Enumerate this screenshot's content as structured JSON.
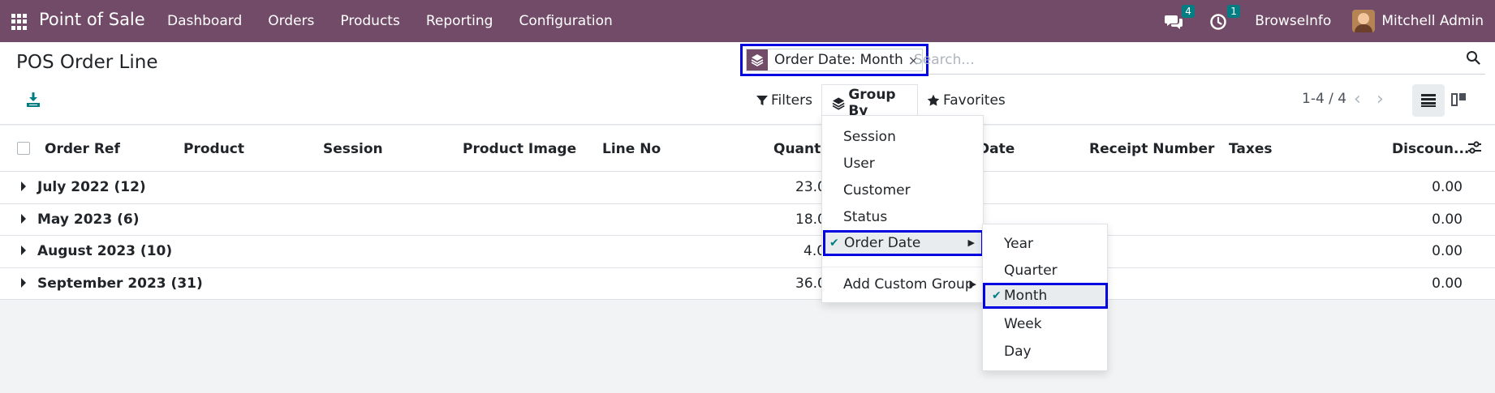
{
  "navbar": {
    "app_name": "Point of Sale",
    "menu": [
      "Dashboard",
      "Orders",
      "Products",
      "Reporting",
      "Configuration"
    ],
    "messages_count": "4",
    "activities_count": "1",
    "company": "BrowseInfo",
    "user": "Mitchell Admin",
    "bg_color": "#714b67"
  },
  "control": {
    "title": "POS Order Line",
    "facet_label": "Order Date: Month",
    "facet_close": "×",
    "search_placeholder": "Search...",
    "filters_label": "Filters",
    "groupby_label": "Group By",
    "favorites_label": "Favorites",
    "pager": "1-4 / 4"
  },
  "table": {
    "columns": [
      "Order Ref",
      "Product",
      "Session",
      "Product Image",
      "Line No",
      "Quantity",
      "Order Date",
      "Receipt Number",
      "Taxes",
      "Discoun..."
    ],
    "visible_columns": {
      "order_ref": "Order Ref",
      "product": "Product",
      "session": "Session",
      "product_image": "Product Image",
      "line_no": "Line No",
      "quantity": "Quantit",
      "order_date": "Date",
      "receipt_number": "Receipt Number",
      "taxes": "Taxes",
      "discount": "Discoun..."
    },
    "groups": [
      {
        "label": "July 2022 (12)",
        "quantity": "23.0",
        "discount": "0.00"
      },
      {
        "label": "May 2023 (6)",
        "quantity": "18.0",
        "discount": "0.00"
      },
      {
        "label": "August 2023 (10)",
        "quantity": "4.0",
        "discount": "0.00"
      },
      {
        "label": "September 2023 (31)",
        "quantity": "36.0",
        "discount": "0.00"
      }
    ]
  },
  "groupby_menu": {
    "items": [
      "Session",
      "User",
      "Customer",
      "Status",
      "Order Date"
    ],
    "selected": "Order Date",
    "custom": "Add Custom Group"
  },
  "date_submenu": {
    "items": [
      "Year",
      "Quarter",
      "Month",
      "Week",
      "Day"
    ],
    "selected": "Month"
  },
  "colors": {
    "accent": "#017e84",
    "highlight_border": "#0000e0"
  }
}
